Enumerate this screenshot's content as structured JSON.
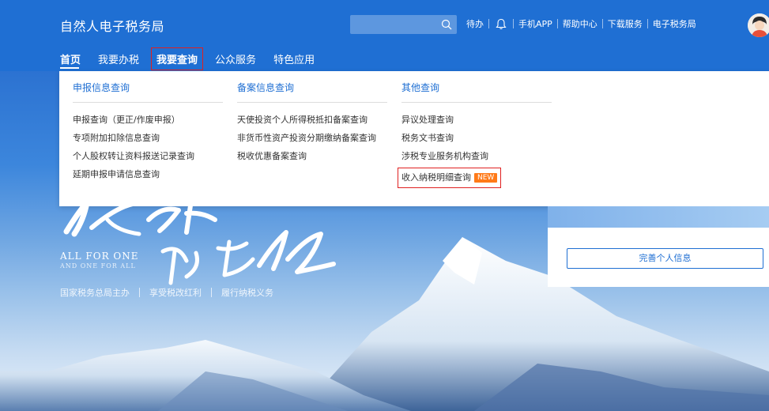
{
  "app": {
    "title": "自然人电子税务局"
  },
  "search": {
    "placeholder": ""
  },
  "toplinks": {
    "todo": "待办",
    "mobile_app": "手机APP",
    "help": "帮助中心",
    "download": "下载服务",
    "etax": "电子税务局"
  },
  "nav": {
    "items": [
      "首页",
      "我要办税",
      "我要查询",
      "公众服务",
      "特色应用"
    ]
  },
  "dropdown": {
    "columns": [
      {
        "title": "申报信息查询",
        "links": [
          "申报查询（更正/作废申报）",
          "专项附加扣除信息查询",
          "个人股权转让资料报送记录查询",
          "延期申报申请信息查询"
        ]
      },
      {
        "title": "备案信息查询",
        "links": [
          "天使投资个人所得税抵扣备案查询",
          "非货币性资产投资分期缴纳备案查询",
          "税收优惠备案查询"
        ]
      },
      {
        "title": "其他查询",
        "links": [
          "异议处理查询",
          "税务文书查询",
          "涉税专业服务机构查询",
          "收入纳税明细查询"
        ],
        "new_badge": "NEW"
      }
    ]
  },
  "hero": {
    "all_for_one": "ALL FOR ONE",
    "one_for_all": "AND ONE FOR ALL",
    "slogan": [
      "国家税务总局主办",
      "享受税改红利",
      "履行纳税义务"
    ]
  },
  "side_panel": {
    "button": "完善个人信息"
  },
  "colors": {
    "brand_blue": "#1f6fd3",
    "highlight_red": "#e02020",
    "badge_orange": "#ff7a18"
  }
}
